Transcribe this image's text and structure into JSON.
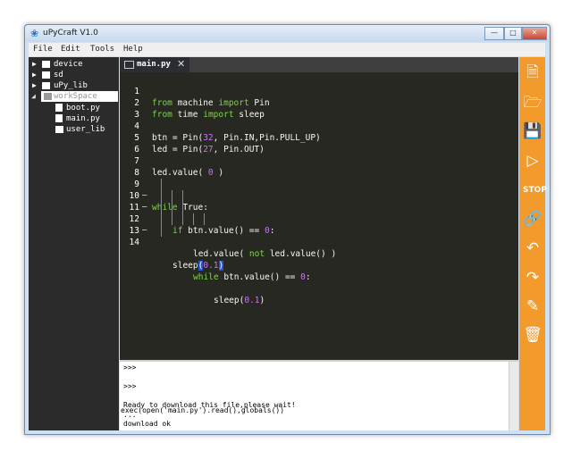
{
  "window": {
    "title": "uPyCraft V1.0"
  },
  "menu": [
    "File",
    "Edit",
    "Tools",
    "Help"
  ],
  "tree": {
    "device": "device",
    "sd": "sd",
    "upy_lib": "uPy_lib",
    "workspace": "workSpace",
    "boot": "boot.py",
    "main": "main.py",
    "user_lib": "user_lib"
  },
  "tab": {
    "label": "main.py"
  },
  "code": [
    {
      "n": "1",
      "t": "from machine import Pin"
    },
    {
      "n": "2",
      "t": "from time import sleep"
    },
    {
      "n": "3",
      "t": ""
    },
    {
      "n": "4",
      "t": "btn = Pin(32, Pin.IN,Pin.PULL_UP)"
    },
    {
      "n": "5",
      "t": "led = Pin(27, Pin.OUT)"
    },
    {
      "n": "6",
      "t": ""
    },
    {
      "n": "7",
      "t": "led.value( 0 )"
    },
    {
      "n": "8",
      "t": ""
    },
    {
      "n": "9",
      "t": "while True:"
    },
    {
      "n": "10",
      "t": "if btn.value() == 0:"
    },
    {
      "n": "11",
      "t": "led.value( not led.value() )"
    },
    {
      "n": "12",
      "t": "while btn.value() == 0:"
    },
    {
      "n": "13",
      "t": "sleep(0.1)"
    },
    {
      "n": "14",
      "t": "sleep(0.1)"
    }
  ],
  "terminal": {
    "lines": [
      ">>>",
      "",
      ">>>",
      "",
      "Ready to download this file,please wait!",
      "...",
      "download ok",
      "exec(open('main.py').read(),globals())"
    ]
  },
  "colors": {
    "toolbar": "#f39a2c",
    "editor_bg": "#272822",
    "keyword": "#7fd34a",
    "number": "#d070ff"
  },
  "toolbar_icons": [
    "new-file-icon",
    "open-file-icon",
    "save-icon",
    "download-run-icon",
    "stop-icon",
    "connect-icon",
    "undo-icon",
    "redo-icon",
    "syntax-check-icon",
    "clear-icon"
  ]
}
